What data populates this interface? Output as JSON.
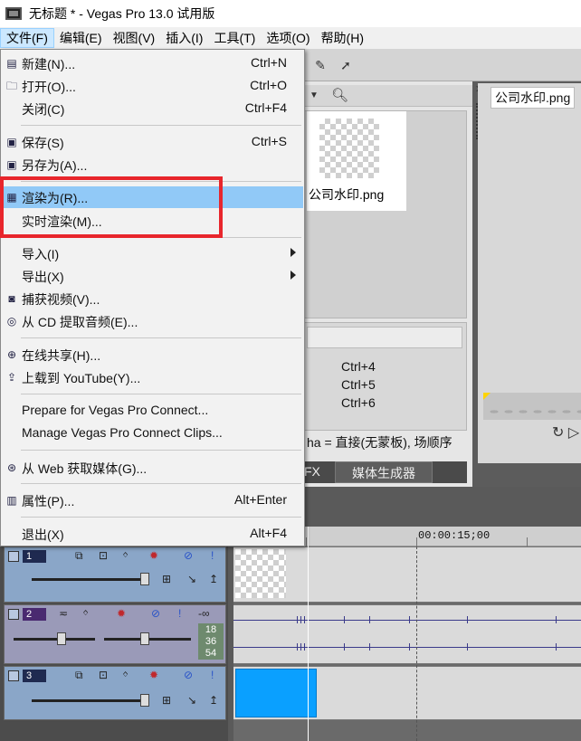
{
  "window": {
    "title": "无标题 * - Vegas Pro 13.0 试用版"
  },
  "menubar": {
    "items": [
      {
        "label": "文件(F)",
        "active": true
      },
      {
        "label": "编辑(E)"
      },
      {
        "label": "视图(V)"
      },
      {
        "label": "插入(I)"
      },
      {
        "label": "工具(T)"
      },
      {
        "label": "选项(O)"
      },
      {
        "label": "帮助(H)"
      }
    ]
  },
  "file_menu": {
    "new": {
      "label": "新建(N)...",
      "shortcut": "Ctrl+N",
      "icon": "new-file-icon"
    },
    "open": {
      "label": "打开(O)...",
      "shortcut": "Ctrl+O",
      "icon": "folder-open-icon"
    },
    "close": {
      "label": "关闭(C)",
      "shortcut": "Ctrl+F4"
    },
    "save": {
      "label": "保存(S)",
      "shortcut": "Ctrl+S",
      "icon": "save-icon"
    },
    "save_as": {
      "label": "另存为(A)...",
      "icon": "save-as-icon"
    },
    "render_as": {
      "label": "渲染为(R)...",
      "icon": "render-icon",
      "highlighted": true
    },
    "realtime_render": {
      "label": "实时渲染(M)..."
    },
    "import": {
      "label": "导入(I)",
      "submenu": true
    },
    "export": {
      "label": "导出(X)",
      "submenu": true
    },
    "capture_video": {
      "label": "捕获视频(V)...",
      "icon": "capture-video-icon"
    },
    "cd_audio": {
      "label": "从 CD 提取音频(E)...",
      "icon": "cd-icon"
    },
    "share_online": {
      "label": "在线共享(H)...",
      "icon": "share-icon"
    },
    "upload_youtube": {
      "label": "上载到 YouTube(Y)...",
      "icon": "upload-icon"
    },
    "prepare_connect": {
      "label": "Prepare for Vegas Pro Connect..."
    },
    "manage_connect": {
      "label": "Manage Vegas Pro Connect Clips..."
    },
    "web_media": {
      "label": "从 Web 获取媒体(G)...",
      "icon": "web-search-icon"
    },
    "properties": {
      "label": "属性(P)...",
      "shortcut": "Alt+Enter",
      "icon": "properties-icon"
    },
    "exit": {
      "label": "退出(X)",
      "shortcut": "Alt+F4"
    }
  },
  "explorer": {
    "thumbnail_name": "公司水印.png",
    "shortcuts": [
      "Ctrl+4",
      "Ctrl+5",
      "Ctrl+6"
    ],
    "alpha_text": "ha = 直接(无蒙板), 场顺序",
    "tabs": [
      "FX",
      "媒体生成器"
    ]
  },
  "preview": {
    "tab_label": "公司水印.png"
  },
  "timeline": {
    "timecode": "00:00:15;00",
    "tracks": [
      {
        "number": "1",
        "type": "video"
      },
      {
        "number": "2",
        "type": "audio",
        "meter": "-∞",
        "levels": [
          "18",
          "36",
          "54"
        ]
      },
      {
        "number": "3",
        "type": "video"
      }
    ]
  },
  "colors": {
    "menu_highlight": "#91c9f7",
    "annotation_box": "#e8262c",
    "blue_clip": "#0aa0ff"
  }
}
